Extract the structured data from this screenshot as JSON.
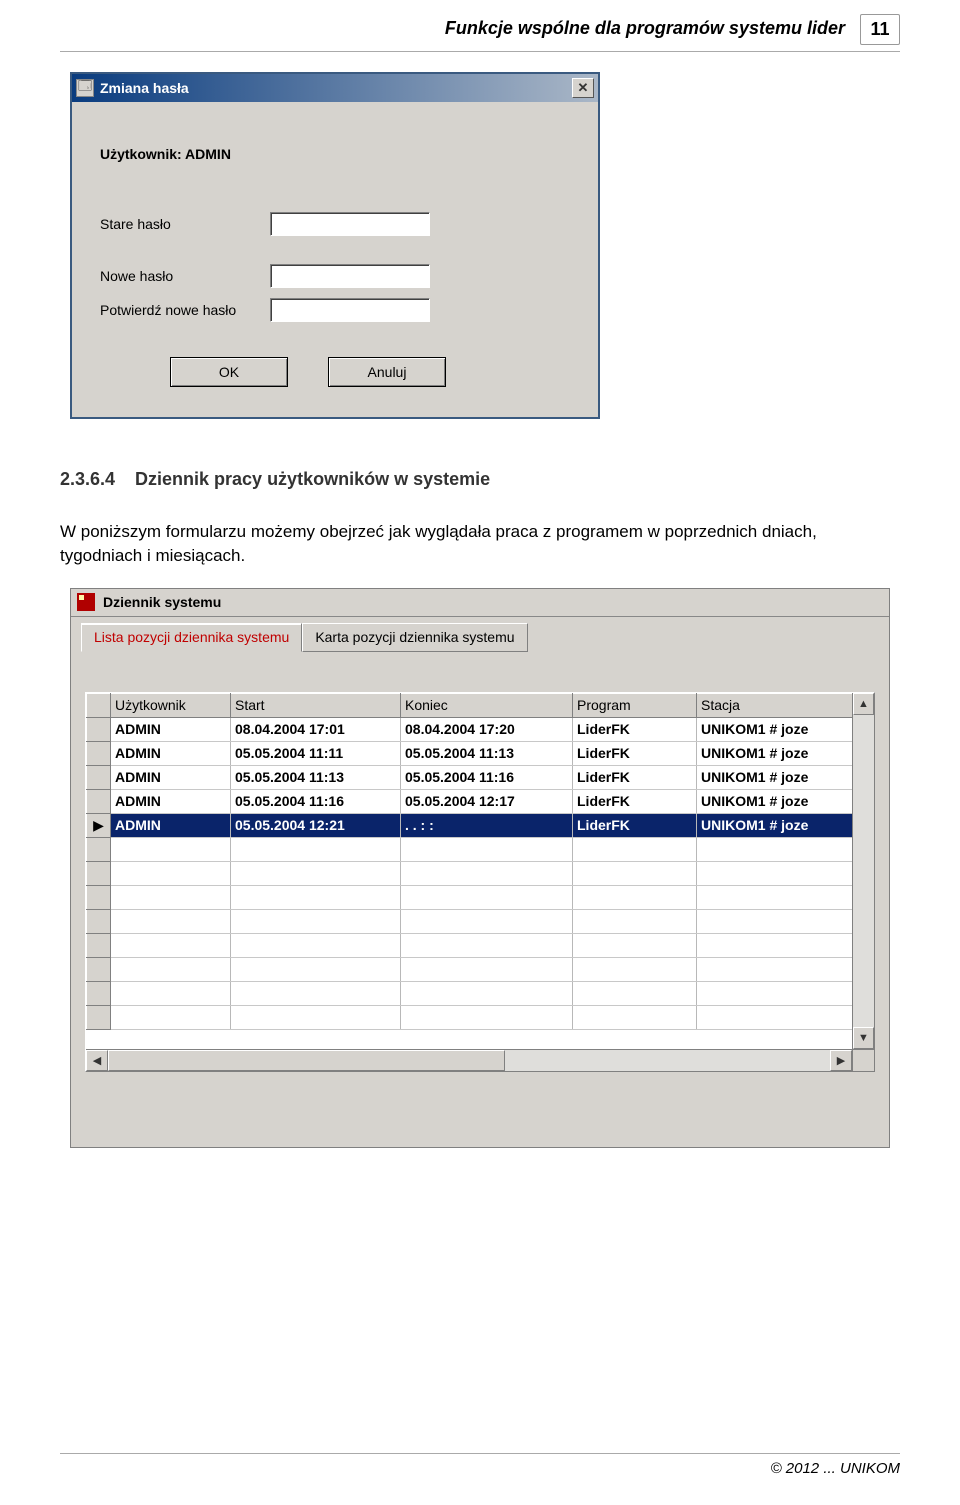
{
  "header": {
    "title": "Funkcje wspólne dla programów systemu lider",
    "page_number": "11"
  },
  "dialog": {
    "title": "Zmiana hasła",
    "user_label": "Użytkownik: ADMIN",
    "labels": {
      "old": "Stare hasło",
      "new": "Nowe hasło",
      "confirm": "Potwierdź nowe hasło"
    },
    "buttons": {
      "ok": "OK",
      "cancel": "Anuluj"
    },
    "close_glyph": "✕"
  },
  "section": {
    "number": "2.3.6.4",
    "title": "Dziennik pracy użytkowników w systemie",
    "paragraph": "W poniższym formularzu możemy obejrzeć jak wyglądała praca z programem w poprzednich dniach, tygodniach i miesiącach."
  },
  "syswin": {
    "title": "Dziennik systemu",
    "tabs": {
      "active": "Lista pozycji dziennika systemu",
      "inactive": "Karta pozycji dziennika systemu"
    },
    "columns": [
      "Użytkownik",
      "Start",
      "Koniec",
      "Program",
      "Stacja"
    ],
    "rows": [
      {
        "mark": "",
        "user": "ADMIN",
        "start": "08.04.2004 17:01",
        "end": "08.04.2004 17:20",
        "program": "LiderFK",
        "station": "UNIKOM1 # joze",
        "selected": false
      },
      {
        "mark": "",
        "user": "ADMIN",
        "start": "05.05.2004 11:11",
        "end": "05.05.2004 11:13",
        "program": "LiderFK",
        "station": "UNIKOM1 # joze",
        "selected": false
      },
      {
        "mark": "",
        "user": "ADMIN",
        "start": "05.05.2004 11:13",
        "end": "05.05.2004 11:16",
        "program": "LiderFK",
        "station": "UNIKOM1 # joze",
        "selected": false
      },
      {
        "mark": "",
        "user": "ADMIN",
        "start": "05.05.2004 11:16",
        "end": "05.05.2004 12:17",
        "program": "LiderFK",
        "station": "UNIKOM1 # joze",
        "selected": false
      },
      {
        "mark": "▶",
        "user": "ADMIN",
        "start": "05.05.2004 12:21",
        "end": ". .     :  :",
        "program": "LiderFK",
        "station": "UNIKOM1 # joze",
        "selected": true
      }
    ],
    "scroll": {
      "up": "▲",
      "down": "▼",
      "left": "◀",
      "right": "▶"
    }
  },
  "footer": "© 2012 ... UNIKOM"
}
